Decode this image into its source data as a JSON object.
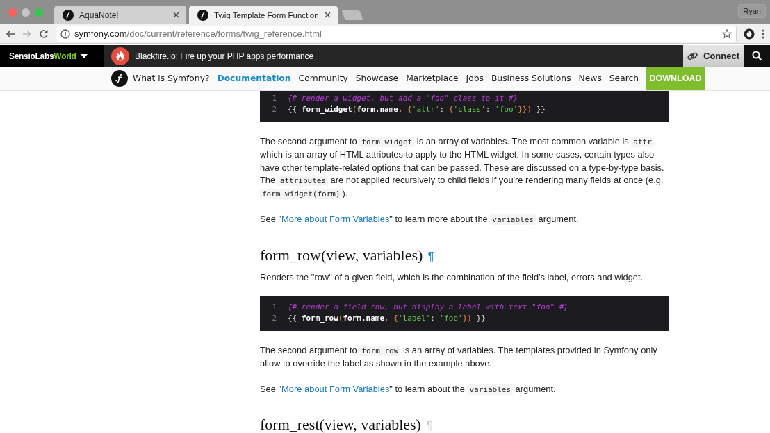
{
  "browser": {
    "tabs": [
      {
        "title": "AquaNote!",
        "selected": false
      },
      {
        "title": "Twig Template Form Function",
        "selected": true
      }
    ],
    "profile": "Ryan",
    "url": {
      "host": "symfony.com",
      "path": "/doc/current/reference/forms/twig_reference.html"
    }
  },
  "topbar": {
    "brand": {
      "name": "SensioLabs",
      "accent": "World"
    },
    "promo": "Blackfire.io: Fire up your PHP apps performance",
    "connect": "Connect"
  },
  "nav": {
    "items": [
      {
        "label": "What is Symfony?",
        "selected": false
      },
      {
        "label": "Documentation",
        "selected": true
      },
      {
        "label": "Community",
        "selected": false
      },
      {
        "label": "Showcase",
        "selected": false
      },
      {
        "label": "Marketplace",
        "selected": false
      },
      {
        "label": "Jobs",
        "selected": false
      },
      {
        "label": "Business Solutions",
        "selected": false
      },
      {
        "label": "News",
        "selected": false
      },
      {
        "label": "Search",
        "selected": false
      }
    ],
    "download": "DOWNLOAD"
  },
  "content": [
    {
      "kind": "code",
      "lines": [
        {
          "number": "1",
          "tokens": [
            {
              "kind": "comment",
              "text": "{# render a widget, but add a \"foo\" class to it #}"
            }
          ]
        },
        {
          "number": "2",
          "tokens": [
            {
              "kind": "plain",
              "text": "{{ "
            },
            {
              "kind": "name",
              "text": "form_widget"
            },
            {
              "kind": "punct",
              "text": "("
            },
            {
              "kind": "name",
              "text": "form.name"
            },
            {
              "kind": "punct",
              "text": ", {"
            },
            {
              "kind": "string",
              "text": "'attr'"
            },
            {
              "kind": "plain",
              "text": ": "
            },
            {
              "kind": "punct",
              "text": "{"
            },
            {
              "kind": "string",
              "text": "'class'"
            },
            {
              "kind": "plain",
              "text": ": "
            },
            {
              "kind": "string",
              "text": "'foo'"
            },
            {
              "kind": "punct",
              "text": "}})"
            },
            {
              "kind": "plain",
              "text": " }}"
            }
          ]
        }
      ]
    },
    {
      "kind": "paragraph",
      "segments": [
        {
          "kind": "text",
          "text": "The second argument to "
        },
        {
          "kind": "code",
          "text": "form_widget"
        },
        {
          "kind": "text",
          "text": " is an array of variables. The most common variable is "
        },
        {
          "kind": "code",
          "text": "attr"
        },
        {
          "kind": "text",
          "text": ", which is an array of HTML attributes to apply to the HTML widget. In some cases, certain types also have other template-related options that can be passed. These are discussed on a type-by-type basis. The "
        },
        {
          "kind": "code",
          "text": "attributes"
        },
        {
          "kind": "text",
          "text": " are not applied recursively to child fields if you're rendering many fields at once (e.g. "
        },
        {
          "kind": "code",
          "text": "form_widget(form)"
        },
        {
          "kind": "text",
          "text": ")."
        }
      ]
    },
    {
      "kind": "paragraph",
      "segments": [
        {
          "kind": "text",
          "text": "See \""
        },
        {
          "kind": "link",
          "text": "More about Form Variables"
        },
        {
          "kind": "text",
          "text": "\" to learn more about the "
        },
        {
          "kind": "code",
          "text": "variables"
        },
        {
          "kind": "text",
          "text": " argument."
        }
      ]
    },
    {
      "kind": "heading",
      "text": "form_row(view, variables)",
      "anchor": "¶",
      "highlighted": true
    },
    {
      "kind": "paragraph",
      "segments": [
        {
          "kind": "text",
          "text": "Renders the \"row\" of a given field, which is the combination of the field's label, errors and widget."
        }
      ]
    },
    {
      "kind": "code",
      "lines": [
        {
          "number": "1",
          "tokens": [
            {
              "kind": "comment",
              "text": "{# render a field row, but display a label with text \"foo\" #}"
            }
          ]
        },
        {
          "number": "2",
          "tokens": [
            {
              "kind": "plain",
              "text": "{{ "
            },
            {
              "kind": "name",
              "text": "form_row"
            },
            {
              "kind": "punct",
              "text": "("
            },
            {
              "kind": "name",
              "text": "form.name"
            },
            {
              "kind": "punct",
              "text": ", {"
            },
            {
              "kind": "string",
              "text": "'label'"
            },
            {
              "kind": "plain",
              "text": ": "
            },
            {
              "kind": "string",
              "text": "'foo'"
            },
            {
              "kind": "punct",
              "text": "})"
            },
            {
              "kind": "plain",
              "text": " }}"
            }
          ]
        }
      ]
    },
    {
      "kind": "paragraph",
      "segments": [
        {
          "kind": "text",
          "text": "The second argument to "
        },
        {
          "kind": "code",
          "text": "form_row"
        },
        {
          "kind": "text",
          "text": " is an array of variables. The templates provided in Symfony only allow to override the label as shown in the example above."
        }
      ]
    },
    {
      "kind": "paragraph",
      "segments": [
        {
          "kind": "text",
          "text": "See \""
        },
        {
          "kind": "link",
          "text": "More about Form Variables"
        },
        {
          "kind": "text",
          "text": "\" to learn about the "
        },
        {
          "kind": "code",
          "text": "variables"
        },
        {
          "kind": "text",
          "text": " argument."
        }
      ]
    },
    {
      "kind": "heading",
      "text": "form_rest(view, variables)",
      "anchor": "¶",
      "highlighted": false
    }
  ]
}
